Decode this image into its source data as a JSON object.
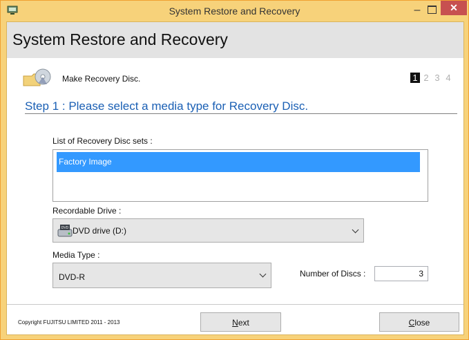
{
  "window": {
    "title": "System Restore and Recovery",
    "minimize_glyph": "–",
    "close_glyph": "✕",
    "accent_color": "#f7d27a",
    "close_color": "#c75050"
  },
  "header": {
    "title": "System Restore and Recovery"
  },
  "task": {
    "label": "Make Recovery Disc.",
    "steps": [
      "1",
      "2",
      "3",
      "4"
    ],
    "active_step": "1"
  },
  "step": {
    "heading": "Step 1 : Please select a media type for Recovery Disc."
  },
  "disc_sets": {
    "label": "List of Recovery Disc sets :",
    "items": [
      {
        "label": "Factory Image",
        "selected": true
      }
    ]
  },
  "drive": {
    "label": "Recordable Drive :",
    "value": "DVD drive (D:)",
    "icon": "dvd-drive-icon"
  },
  "media": {
    "label": "Media Type :",
    "value": "DVD-R"
  },
  "discs": {
    "label": "Number of Discs :",
    "value": "3"
  },
  "footer": {
    "copyright": "Copyright FUJITSU LIMITED 2011 - 2013",
    "next_label": "Next",
    "close_label": "Close"
  }
}
